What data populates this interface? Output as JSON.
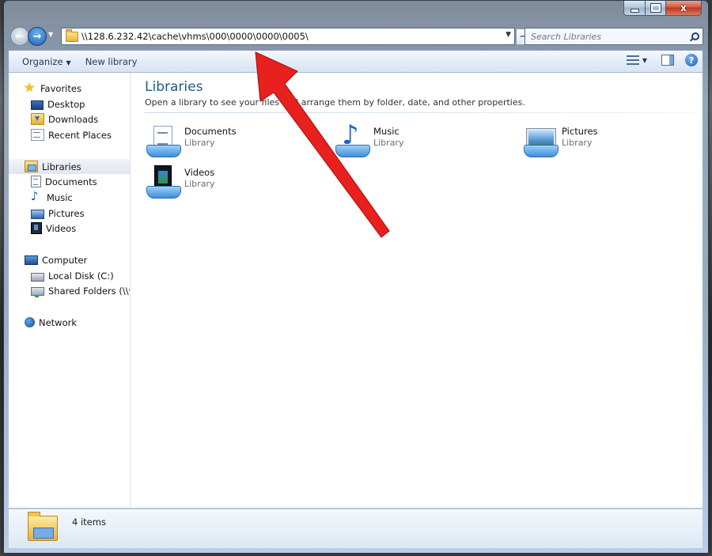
{
  "window": {
    "minimize_label": "",
    "maximize_label": "",
    "close_label": "x"
  },
  "navbar": {
    "back_glyph": "←",
    "forward_glyph": "→",
    "address": "\\\\128.6.232.42\\cache\\vhms\\000\\0000\\0000\\0005\\",
    "go_glyph": "→",
    "search_placeholder": "Search Libraries"
  },
  "toolbar": {
    "organize_label": "Organize",
    "new_library_label": "New library"
  },
  "sidebar": {
    "favorites": {
      "label": "Favorites",
      "icon": "star-icon",
      "items": [
        {
          "label": "Desktop",
          "icon": "desktop-icon"
        },
        {
          "label": "Downloads",
          "icon": "downloads-icon"
        },
        {
          "label": "Recent Places",
          "icon": "recent-icon"
        }
      ]
    },
    "libraries": {
      "label": "Libraries",
      "icon": "libraries-icon",
      "items": [
        {
          "label": "Documents",
          "icon": "documents-icon"
        },
        {
          "label": "Music",
          "icon": "music-icon"
        },
        {
          "label": "Pictures",
          "icon": "pictures-icon"
        },
        {
          "label": "Videos",
          "icon": "videos-icon"
        }
      ]
    },
    "computer": {
      "label": "Computer",
      "icon": "computer-icon",
      "items": [
        {
          "label": "Local Disk (C:)",
          "icon": "disk-icon"
        },
        {
          "label": "Shared Folders (\\\\vn",
          "icon": "shared-folder-icon"
        }
      ]
    },
    "network": {
      "label": "Network",
      "icon": "network-icon"
    }
  },
  "main": {
    "title": "Libraries",
    "subtitle": "Open a library to see your files and arrange them by folder, date, and other properties.",
    "libraries": [
      {
        "name": "Documents",
        "kind": "Library",
        "icon": "documents-library-icon"
      },
      {
        "name": "Music",
        "kind": "Library",
        "icon": "music-library-icon"
      },
      {
        "name": "Pictures",
        "kind": "Library",
        "icon": "pictures-library-icon"
      },
      {
        "name": "Videos",
        "kind": "Library",
        "icon": "videos-library-icon"
      }
    ]
  },
  "statusbar": {
    "item_count": "4 items"
  },
  "annotation": {
    "arrow_color": "#e8201e"
  }
}
